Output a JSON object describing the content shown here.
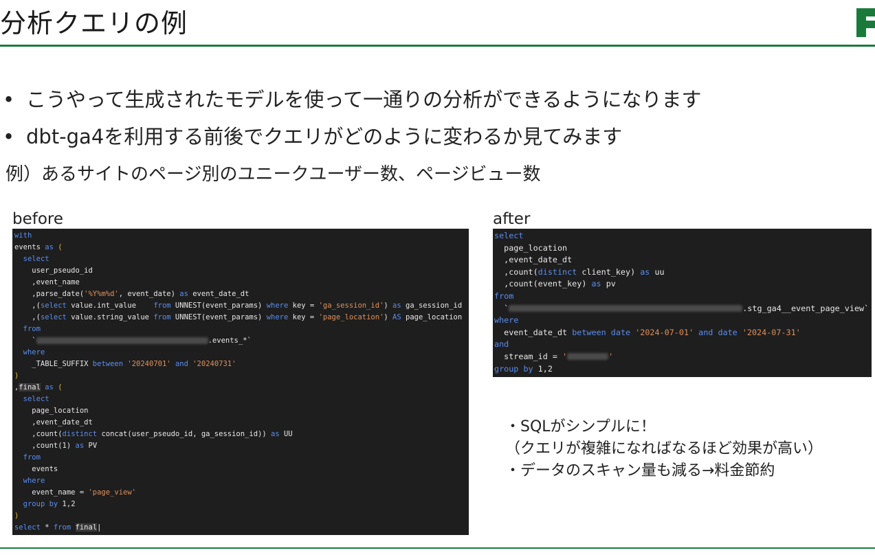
{
  "slide": {
    "title": "分析クエリの例",
    "bullets": [
      "こうやって生成されたモデルを使って一通りの分析ができるようになります",
      "dbt-ga4を利用する前後でクエリがどのように変わるか見てみます"
    ],
    "example": "例）あるサイトのページ別のユニークユーザー数、ページビュー数",
    "before_label": "before",
    "after_label": "after",
    "notes": [
      "・SQLがシンプルに！",
      "（クエリが複雑になればなるほど効果が高い）",
      "・データのスキャン量も減る→料金節約"
    ]
  },
  "colors": {
    "accent": "#1a7a3c",
    "code_bg": "#1e1e1e",
    "keyword": "#5a8ef0",
    "string": "#e0905a"
  }
}
